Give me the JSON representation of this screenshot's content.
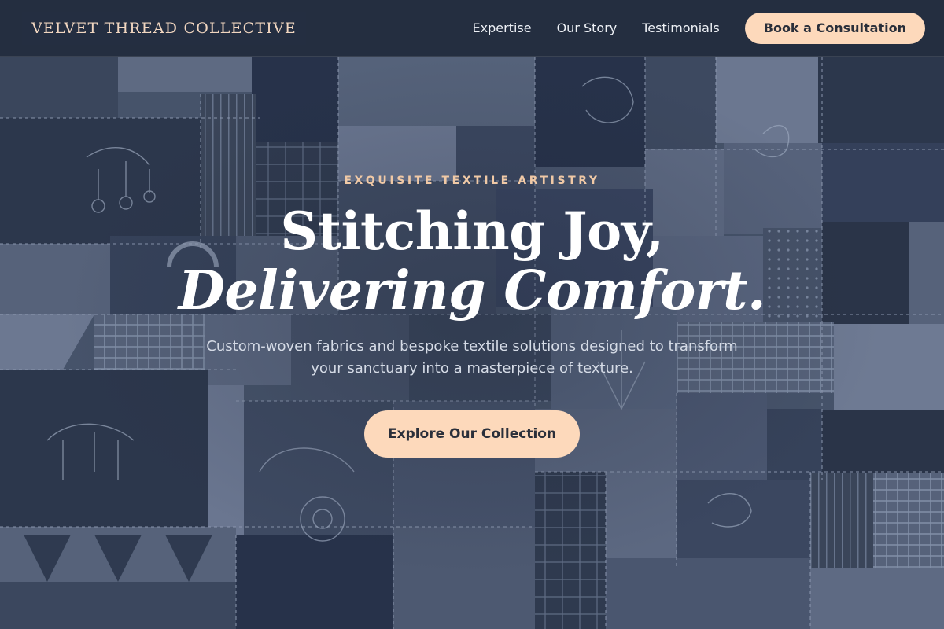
{
  "header": {
    "brand": "VELVET THREAD COLLECTIVE",
    "nav": [
      {
        "label": "Expertise"
      },
      {
        "label": "Our Story"
      },
      {
        "label": "Testimonials"
      }
    ],
    "cta_label": "Book a Consultation"
  },
  "hero": {
    "eyebrow": "EXQUISITE TEXTILE ARTISTRY",
    "headline_line1": "Stitching Joy,",
    "headline_line2": "Delivering Comfort.",
    "subtitle": "Custom-woven fabrics and bespoke textile solutions designed to transform your sanctuary into a masterpiece of texture.",
    "cta_label": "Explore Our Collection"
  },
  "colors": {
    "header_bg": "#202a3c",
    "brand_text": "#f1d6c0",
    "accent": "#fdd9bb",
    "eyebrow": "#f0c9a6",
    "headline": "#ffffff",
    "subtitle": "#d5dbe6",
    "quilt_base": "#3d4a60"
  },
  "background": {
    "description_icon": "patchwork-quilt-image"
  }
}
